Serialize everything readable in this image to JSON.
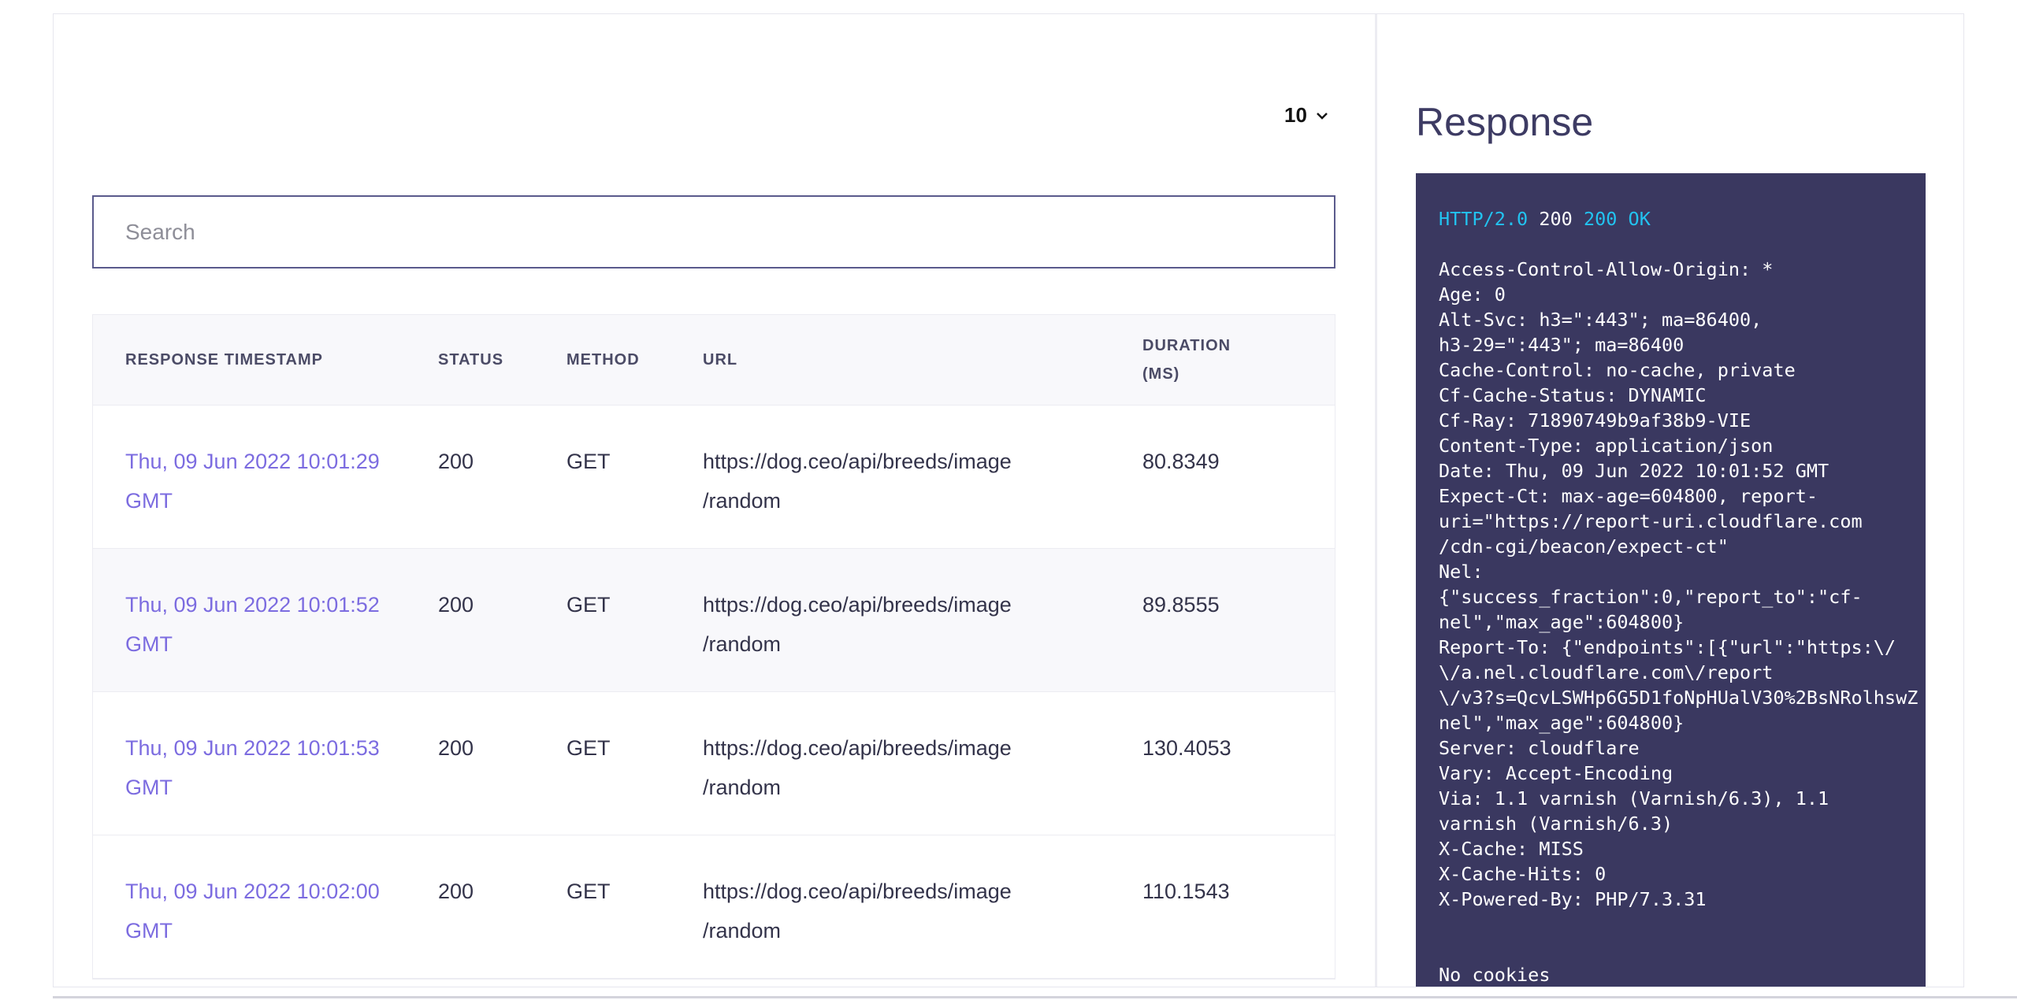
{
  "left": {
    "page_size": "10",
    "search": {
      "placeholder": "Search",
      "value": ""
    },
    "table": {
      "columns": [
        "RESPONSE TIMESTAMP",
        "STATUS",
        "METHOD",
        "URL",
        "DURATION",
        "(MS)"
      ],
      "rows": [
        {
          "ts1": "Thu, 09 Jun 2022 10:01:29",
          "ts2": "GMT",
          "status": "200",
          "method": "GET",
          "url1": "https://dog.ceo/api/breeds/image",
          "url2": "/random",
          "duration": "80.8349"
        },
        {
          "ts1": "Thu, 09 Jun 2022 10:01:52",
          "ts2": "GMT",
          "status": "200",
          "method": "GET",
          "url1": "https://dog.ceo/api/breeds/image",
          "url2": "/random",
          "duration": "89.8555"
        },
        {
          "ts1": "Thu, 09 Jun 2022 10:01:53",
          "ts2": "GMT",
          "status": "200",
          "method": "GET",
          "url1": "https://dog.ceo/api/breeds/image",
          "url2": "/random",
          "duration": "130.4053"
        },
        {
          "ts1": "Thu, 09 Jun 2022 10:02:00",
          "ts2": "GMT",
          "status": "200",
          "method": "GET",
          "url1": "https://dog.ceo/api/breeds/image",
          "url2": "/random",
          "duration": "110.1543"
        }
      ]
    }
  },
  "right": {
    "title": "Response",
    "status_line": {
      "protocol": "HTTP/2.0",
      "code": "200",
      "text": "200 OK"
    },
    "headers": [
      "Access-Control-Allow-Origin: *",
      "Age: 0",
      "Alt-Svc: h3=\":443\"; ma=86400,",
      "h3-29=\":443\"; ma=86400",
      "Cache-Control: no-cache, private",
      "Cf-Cache-Status: DYNAMIC",
      "Cf-Ray: 71890749b9af38b9-VIE",
      "Content-Type: application/json",
      "Date: Thu, 09 Jun 2022 10:01:52 GMT",
      "Expect-Ct: max-age=604800, report-",
      "uri=\"https://report-uri.cloudflare.com",
      "/cdn-cgi/beacon/expect-ct\"",
      "Nel:",
      "{\"success_fraction\":0,\"report_to\":\"cf-",
      "nel\",\"max_age\":604800}",
      "Report-To: {\"endpoints\":[{\"url\":\"https:\\/",
      "\\/a.nel.cloudflare.com\\/report",
      "\\/v3?s=QcvLSWHp6G5D1foNpHUalV30%2BsNRolhswZ",
      "nel\",\"max_age\":604800}",
      "Server: cloudflare",
      "Vary: Accept-Encoding",
      "Via: 1.1 varnish (Varnish/6.3), 1.1",
      "varnish (Varnish/6.3)",
      "X-Cache: MISS",
      "X-Cache-Hits: 0",
      "X-Powered-By: PHP/7.3.31"
    ],
    "cookies": "No cookies"
  }
}
